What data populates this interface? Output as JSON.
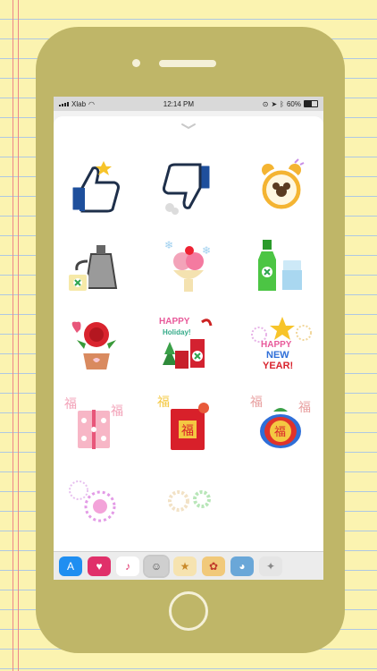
{
  "status_bar": {
    "carrier": "Xlab",
    "time": "12:14 PM",
    "battery_pct": "60%"
  },
  "stickers": [
    {
      "name": "thumbs-up-sticker"
    },
    {
      "name": "thumbs-down-sticker"
    },
    {
      "name": "alarm-clock-sticker"
    },
    {
      "name": "kettle-tea-sticker"
    },
    {
      "name": "sundae-sticker"
    },
    {
      "name": "soda-bottle-sticker"
    },
    {
      "name": "flower-pot-sticker"
    },
    {
      "name": "happy-holiday-sticker",
      "text_top": "HAPPY",
      "text_bottom": "Holiday!"
    },
    {
      "name": "happy-new-year-sticker",
      "text_1": "HAPPY",
      "text_2": "NEW",
      "text_3": "YEAR!"
    },
    {
      "name": "fu-gift-box-sticker",
      "char": "福"
    },
    {
      "name": "fu-red-envelope-sticker",
      "char": "福"
    },
    {
      "name": "fu-lucky-bag-sticker",
      "char": "福"
    },
    {
      "name": "pink-snowflake-sticker"
    },
    {
      "name": "white-wreath-sticker"
    }
  ],
  "app_drawer": [
    {
      "name": "app-store-icon",
      "color": "#1f8ef1",
      "glyph": "A"
    },
    {
      "name": "heart-app-icon",
      "color": "#e0306a",
      "glyph": "♥"
    },
    {
      "name": "music-icon",
      "color": "#ffffff",
      "glyph": "♪"
    },
    {
      "name": "sticker-pack-icon",
      "color": "#cfcfcf",
      "glyph": "☺",
      "selected": true
    },
    {
      "name": "sticker-pack-2-icon",
      "color": "#f6e3b0",
      "glyph": "★"
    },
    {
      "name": "sticker-pack-3-icon",
      "color": "#f1c97a",
      "glyph": "✿"
    },
    {
      "name": "sticker-pack-4-icon",
      "color": "#6aa7d8",
      "glyph": "◕"
    },
    {
      "name": "sticker-pack-5-icon",
      "color": "#e5e5e5",
      "glyph": "✦"
    }
  ]
}
